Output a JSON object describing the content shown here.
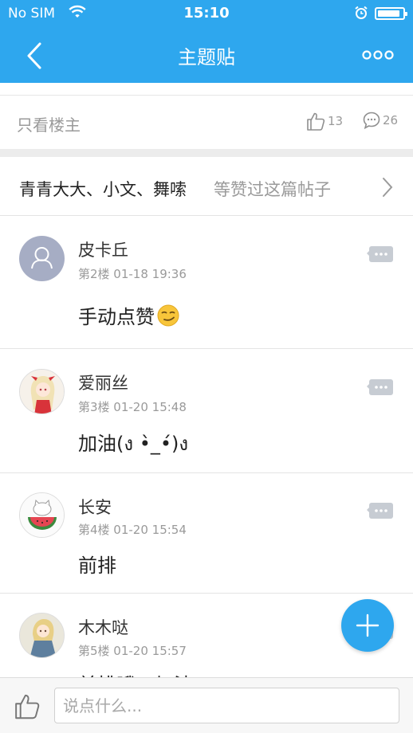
{
  "status_bar": {
    "carrier": "No SIM",
    "time": "15:10",
    "battery_level": 0.9
  },
  "nav": {
    "title": "主题贴",
    "back_icon": "chevron-left-icon",
    "more_icon": "more-dots-icon"
  },
  "filter": {
    "only_author_label": "只看楼主",
    "like_count": "13",
    "comment_count": "26"
  },
  "likers": {
    "names": "青青大大、小文、舞嗦",
    "suffix": "等赞过这篇帖子"
  },
  "posts": [
    {
      "author": "皮卡丘",
      "meta": "第2楼 01-18 19:36",
      "content": "手动点赞",
      "emoji": "smirk-emoji"
    },
    {
      "author": "爱丽丝",
      "meta": "第3楼 01-20 15:48",
      "content": "加油(ง •̀_•́)ง"
    },
    {
      "author": "长安",
      "meta": "第4楼 01-20 15:54",
      "content": "前排"
    },
    {
      "author": "木木哒",
      "meta": "第5楼 01-20 15:57",
      "content": "前排哦，加油"
    }
  ],
  "composer": {
    "placeholder": "说点什么..."
  },
  "colors": {
    "accent": "#2ea7ee",
    "muted_text": "#9a9a9a",
    "reply_icon": "#c7ccd3"
  }
}
